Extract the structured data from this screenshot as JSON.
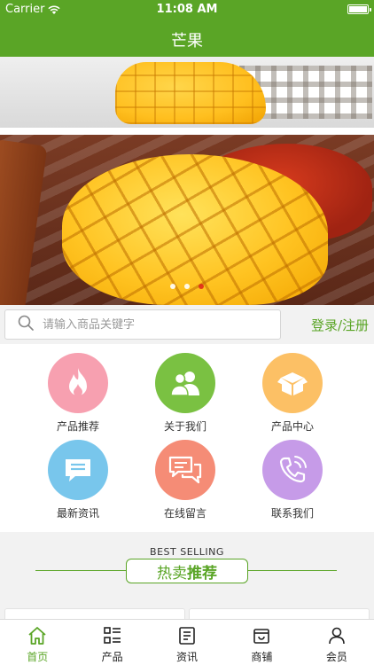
{
  "status_bar": {
    "carrier": "Carrier",
    "time": "11:08 AM"
  },
  "nav": {
    "title": "芒果"
  },
  "banner": {
    "slide_count": 3,
    "active_index": 2,
    "active_dot_color": "#e02a1a"
  },
  "search": {
    "placeholder": "请输入商品关键字",
    "login_register": "登录/注册"
  },
  "menu": [
    {
      "label": "产品推荐",
      "icon": "flame-icon",
      "color": "#f7a0b0"
    },
    {
      "label": "关于我们",
      "icon": "users-icon",
      "color": "#7ac142"
    },
    {
      "label": "产品中心",
      "icon": "box-icon",
      "color": "#fcc065"
    },
    {
      "label": "最新资讯",
      "icon": "message-icon",
      "color": "#78c6ec"
    },
    {
      "label": "在线留言",
      "icon": "chat-bubbles-icon",
      "color": "#f58c76"
    },
    {
      "label": "联系我们",
      "icon": "phone-icon",
      "color": "#c69be8"
    }
  ],
  "best_selling": {
    "english": "BEST SELLING",
    "title_part1": "热卖",
    "title_part2": "推荐"
  },
  "tabbar": [
    {
      "label": "首页",
      "icon": "home-icon",
      "active": true
    },
    {
      "label": "产品",
      "icon": "grid-list-icon",
      "active": false
    },
    {
      "label": "资讯",
      "icon": "news-icon",
      "active": false
    },
    {
      "label": "商铺",
      "icon": "store-icon",
      "active": false
    },
    {
      "label": "会员",
      "icon": "user-icon",
      "active": false
    }
  ],
  "colors": {
    "brand_green": "#5aa526",
    "background_gray": "#f2f2f2"
  }
}
